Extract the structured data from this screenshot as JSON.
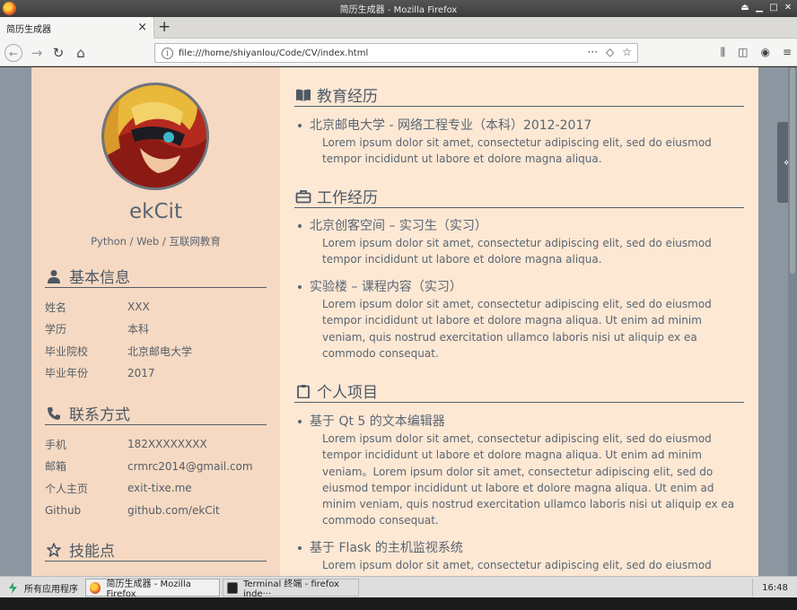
{
  "window": {
    "title": "简历生成器 - Mozilla Firefox"
  },
  "browser": {
    "tab_title": "简历生成器",
    "url": "file:///home/shiyanlou/Code/CV/index.html"
  },
  "profile": {
    "name": "ekCit",
    "tagline": "Python / Web / 互联网教育"
  },
  "sidebar": {
    "basic_info": {
      "title": "基本信息",
      "rows": [
        {
          "k": "姓名",
          "v": "XXX"
        },
        {
          "k": "学历",
          "v": "本科"
        },
        {
          "k": "毕业院校",
          "v": "北京邮电大学"
        },
        {
          "k": "毕业年份",
          "v": "2017"
        }
      ]
    },
    "contact": {
      "title": "联系方式",
      "rows": [
        {
          "k": "手机",
          "v": "182XXXXXXXX"
        },
        {
          "k": "邮箱",
          "v": "crmrc2014@gmail.com"
        },
        {
          "k": "个人主页",
          "v": "exit-tixe.me"
        },
        {
          "k": "Github",
          "v": "github.com/ekCit"
        }
      ]
    },
    "skills": {
      "title": "技能点"
    }
  },
  "main": {
    "education": {
      "title": "教育经历",
      "entries": [
        {
          "title": "北京邮电大学 - 网络工程专业（本科）2012-2017",
          "desc": "Lorem ipsum dolor sit amet, consectetur adipiscing elit, sed do eiusmod tempor incididunt ut labore et dolore magna aliqua."
        }
      ]
    },
    "work": {
      "title": "工作经历",
      "entries": [
        {
          "title": "北京创客空间 – 实习生（实习）",
          "desc": "Lorem ipsum dolor sit amet, consectetur adipiscing elit, sed do eiusmod tempor incididunt ut labore et dolore magna aliqua."
        },
        {
          "title": "实验楼 – 课程内容（实习）",
          "desc": "Lorem ipsum dolor sit amet, consectetur adipiscing elit, sed do eiusmod tempor incididunt ut labore et dolore magna aliqua. Ut enim ad minim veniam, quis nostrud exercitation ullamco laboris nisi ut aliquip ex ea commodo consequat."
        }
      ]
    },
    "projects": {
      "title": "个人项目",
      "entries": [
        {
          "title": "基于 Qt 5 的文本编辑器",
          "desc": "Lorem ipsum dolor sit amet, consectetur adipiscing elit, sed do eiusmod tempor incididunt ut labore et dolore magna aliqua. Ut enim ad minim veniam。Lorem ipsum dolor sit amet, consectetur adipiscing elit, sed do eiusmod tempor incididunt ut labore et dolore magna aliqua. Ut enim ad minim veniam, quis nostrud exercitation ullamco laboris nisi ut aliquip ex ea commodo consequat."
        },
        {
          "title": "基于 Flask 的主机监视系统",
          "desc": "Lorem ipsum dolor sit amet, consectetur adipiscing elit, sed do eiusmod"
        }
      ]
    }
  },
  "taskbar": {
    "apps_label": "所有应用程序",
    "tasks": [
      "简历生成器 - Mozilla Firefox",
      "Terminal 终端 - firefox inde···"
    ],
    "clock": "16:48"
  }
}
